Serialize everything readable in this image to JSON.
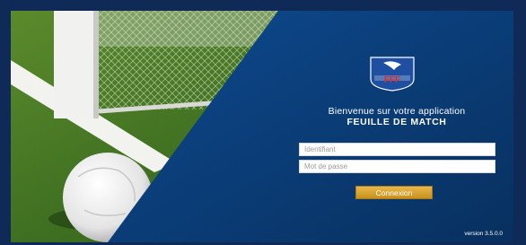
{
  "login": {
    "welcome_line": "Bienvenue sur votre application",
    "app_name": "FEUILLE DE MATCH",
    "username_placeholder": "Identifiant",
    "password_placeholder": "Mot de passe",
    "submit_label": "Connexion",
    "version": "version 3.5.0.0"
  },
  "logo": {
    "icon": "fff-federation-logo",
    "text": "FFF"
  },
  "background": {
    "icon": "football-goal-photo"
  },
  "colors": {
    "panel_blue": "#0b3d78",
    "button_gold": "#d4a22e",
    "field_white": "#ffffff",
    "frame": "#0f2a57"
  }
}
